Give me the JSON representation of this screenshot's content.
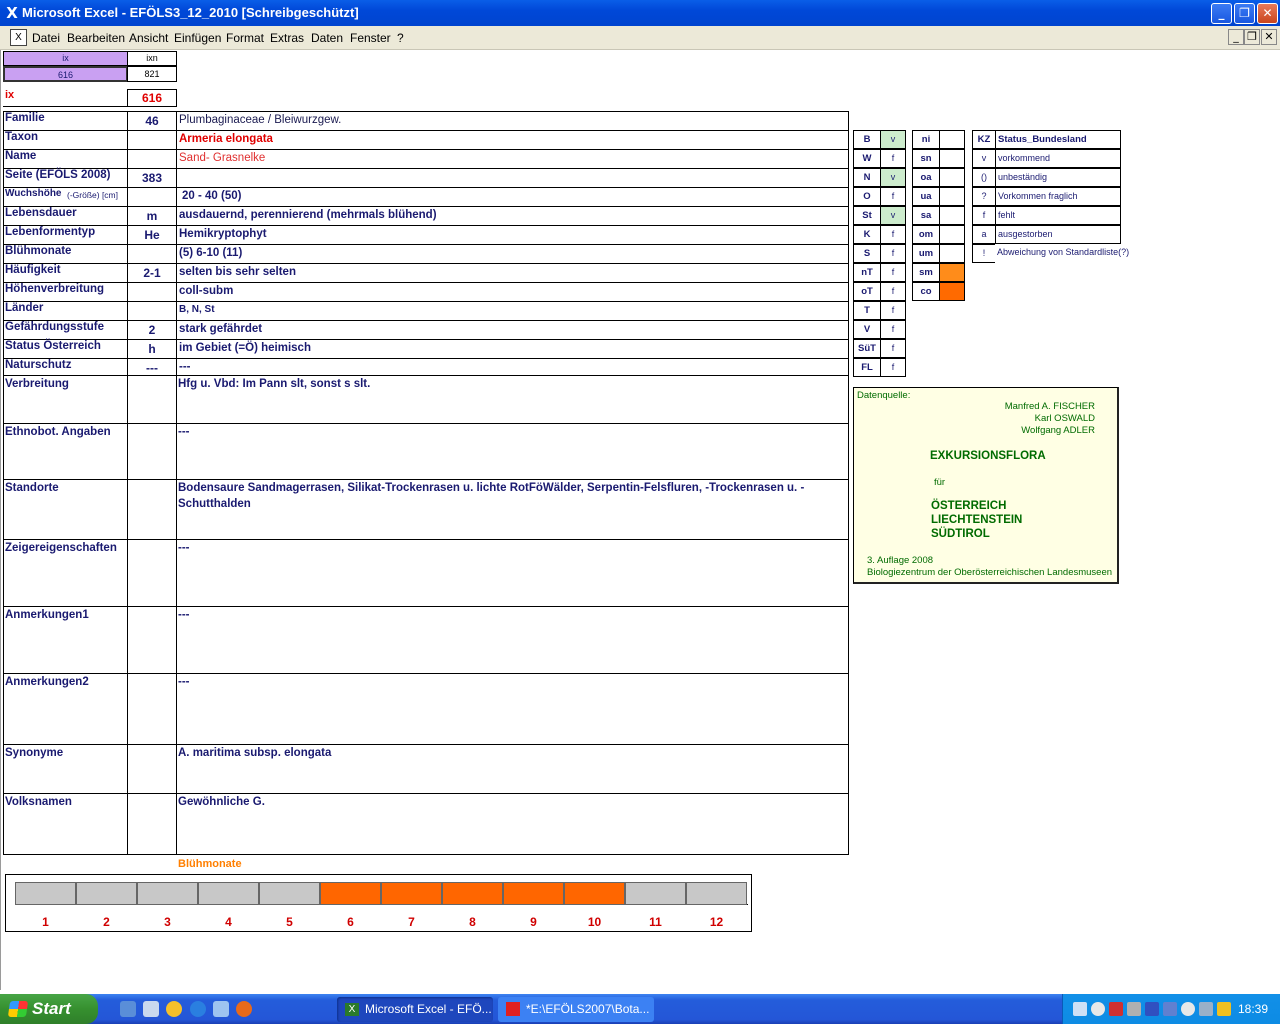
{
  "window": {
    "title": "Microsoft Excel - EFÖLS3_12_2010  [Schreibgeschützt]",
    "buttons": {
      "minimize": "_",
      "restore": "❐",
      "close": "✕"
    }
  },
  "menu": {
    "items": [
      "Datei",
      "Bearbeiten",
      "Ansicht",
      "Einfügen",
      "Format",
      "Extras",
      "Daten",
      "Fenster",
      "?"
    ],
    "doc_buttons": {
      "minimize": "_",
      "restore": "❐",
      "close": "✕"
    }
  },
  "index": {
    "ix_header": "ix",
    "ixn_header": "ixn",
    "ix_value": "616",
    "ixn_value": "821",
    "ix_label": "ix",
    "ix_big_value": "616"
  },
  "rows": [
    {
      "label": "Familie",
      "code": "46",
      "value": "Plumbaginaceae  /  Bleiwurzgew."
    },
    {
      "label": "Taxon",
      "code": "",
      "value": "Armeria elongata"
    },
    {
      "label": "Name",
      "code": "",
      "value": "Sand- Grasnelke"
    },
    {
      "label": "Seite (EFÖLS 2008)",
      "code": "383",
      "value": ""
    },
    {
      "label": "Wuchshöhe",
      "label_suffix": "(-Größe) [cm]",
      "code": "",
      "value": "20 - 40 (50)"
    },
    {
      "label": "Lebensdauer",
      "code": "m",
      "value": "ausdauernd, perennierend (mehrmals blühend)"
    },
    {
      "label": "Lebenformentyp",
      "code": "He",
      "value": "Hemikryptophyt"
    },
    {
      "label": "Blühmonate",
      "code": "",
      "value": "(5) 6-10 (11)"
    },
    {
      "label": "Häufigkeit",
      "code": "2-1",
      "value": "selten bis sehr selten"
    },
    {
      "label": "Höhenverbreitung",
      "code": "",
      "value": "coll-subm"
    },
    {
      "label": "Länder",
      "code": "",
      "value": "B, N, St"
    },
    {
      "label": "Gefährdungsstufe",
      "code": "2",
      "value": "stark gefährdet"
    },
    {
      "label": "Status Österreich",
      "code": "h",
      "value": "im Gebiet (=Ö) heimisch"
    },
    {
      "label": "Naturschutz",
      "code": "---",
      "value": "---"
    }
  ],
  "tall_rows": [
    {
      "label": "Verbreitung",
      "value": "Hfg u. Vbd: Im Pann slt, sonst s slt."
    },
    {
      "label": "Ethnobot. Angaben",
      "value": "---"
    },
    {
      "label": "Standorte",
      "value": "Bodensaure Sandmagerrasen, Silikat-Trockenrasen u. lichte RotFöWälder, Serpentin-Felsfluren, -Trockenrasen u. -",
      "value2": "Schutthalden"
    },
    {
      "label": "Zeigereigenschaften",
      "value": "---"
    },
    {
      "label": "Anmerkungen1",
      "value": "---"
    },
    {
      "label": "Anmerkungen2",
      "value": "---"
    },
    {
      "label": "Synonyme",
      "value": "A. maritima subsp. elongata"
    },
    {
      "label": "Volksnamen",
      "value": "Gewöhnliche G."
    }
  ],
  "states": [
    {
      "code": "B",
      "val": "v"
    },
    {
      "code": "W",
      "val": "f"
    },
    {
      "code": "N",
      "val": "v"
    },
    {
      "code": "O",
      "val": "f"
    },
    {
      "code": "St",
      "val": "v"
    },
    {
      "code": "K",
      "val": "f"
    },
    {
      "code": "S",
      "val": "f"
    },
    {
      "code": "nT",
      "val": "f"
    },
    {
      "code": "oT",
      "val": "f"
    },
    {
      "code": "T",
      "val": "f"
    },
    {
      "code": "V",
      "val": "f"
    },
    {
      "code": "SüT",
      "val": "f"
    },
    {
      "code": "FL",
      "val": "f"
    }
  ],
  "altitude": [
    {
      "code": "ni",
      "state": "none"
    },
    {
      "code": "sn",
      "state": "none"
    },
    {
      "code": "oa",
      "state": "none"
    },
    {
      "code": "ua",
      "state": "none"
    },
    {
      "code": "sa",
      "state": "none"
    },
    {
      "code": "om",
      "state": "none"
    },
    {
      "code": "um",
      "state": "none"
    },
    {
      "code": "sm",
      "state": "on"
    },
    {
      "code": "co",
      "state": "on"
    }
  ],
  "legend": {
    "header_k": "KZ",
    "header_v": "Status_Bundesland",
    "items": [
      {
        "k": "v",
        "v": "vorkommend"
      },
      {
        "k": "()",
        "v": "unbeständig"
      },
      {
        "k": "?",
        "v": "Vorkommen fraglich"
      },
      {
        "k": "f",
        "v": "fehlt"
      },
      {
        "k": "a",
        "v": "ausgestorben"
      },
      {
        "k": "!",
        "v": "Abweichung von Standardliste(?)"
      }
    ]
  },
  "source": {
    "label": "Datenquelle:",
    "authors": [
      "Manfred A. FISCHER",
      "Karl OSWALD",
      "Wolfgang ADLER"
    ],
    "book": "EXKURSIONSFLORA",
    "fuer": "für",
    "regions": [
      "ÖSTERREICH",
      "LIECHTENSTEIN",
      "SÜDTIROL"
    ],
    "edition": "3. Auflage 2008",
    "publisher": "Biologiezentrum der Oberösterreichischen Landesmuseen"
  },
  "bloom_chart": {
    "title": "Blühmonate",
    "months": [
      "1",
      "2",
      "3",
      "4",
      "5",
      "6",
      "7",
      "8",
      "9",
      "10",
      "11",
      "12"
    ],
    "active": [
      false,
      false,
      false,
      false,
      false,
      true,
      true,
      true,
      true,
      true,
      false,
      false
    ],
    "colors": {
      "active": "#ff6600",
      "inactive": "#c8c8c8"
    }
  },
  "taskbar": {
    "start": "Start",
    "tasks": [
      "Microsoft Excel - EFÖ...",
      "*E:\\EFÖLS2007\\Bota..."
    ],
    "clock": "18:39"
  }
}
